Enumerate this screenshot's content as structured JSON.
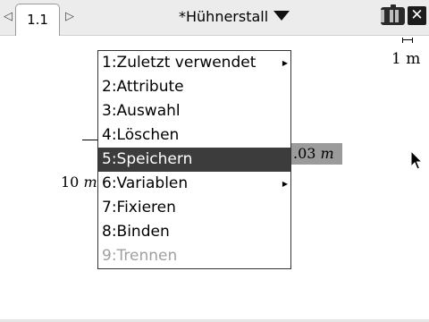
{
  "tab": {
    "label": "1.1"
  },
  "document": {
    "title": "*Hühnerstall"
  },
  "canvas": {
    "scale_label": "1 m",
    "left_measure": {
      "value": "10",
      "unit": "m"
    },
    "right_measure": {
      "value": ".03",
      "unit": "m"
    }
  },
  "menu": {
    "items": [
      {
        "label": "1:Zuletzt verwendet",
        "state": "normal",
        "submenu": true
      },
      {
        "label": "2:Attribute",
        "state": "normal",
        "submenu": false
      },
      {
        "label": "3:Auswahl",
        "state": "normal",
        "submenu": false
      },
      {
        "label": "4:Löschen",
        "state": "normal",
        "submenu": false
      },
      {
        "label": "5:Speichern",
        "state": "selected",
        "submenu": false
      },
      {
        "label": "6:Variablen",
        "state": "normal",
        "submenu": true
      },
      {
        "label": "7:Fixieren",
        "state": "normal",
        "submenu": false
      },
      {
        "label": "8:Binden",
        "state": "normal",
        "submenu": false
      },
      {
        "label": "9:Trennen",
        "state": "disabled",
        "submenu": false
      }
    ]
  },
  "icons": {
    "prev": "tab-prev-icon",
    "next": "tab-next-icon",
    "dropdown": "chevron-down-icon",
    "battery": "battery-icon",
    "close": "close-icon",
    "submenu": "submenu-arrow-icon",
    "cursor": "mouse-pointer-icon"
  },
  "colors": {
    "selection": "#3c3c3c",
    "disabled_text": "#a0a0a0",
    "measure_highlight": "#9b9b9b"
  }
}
